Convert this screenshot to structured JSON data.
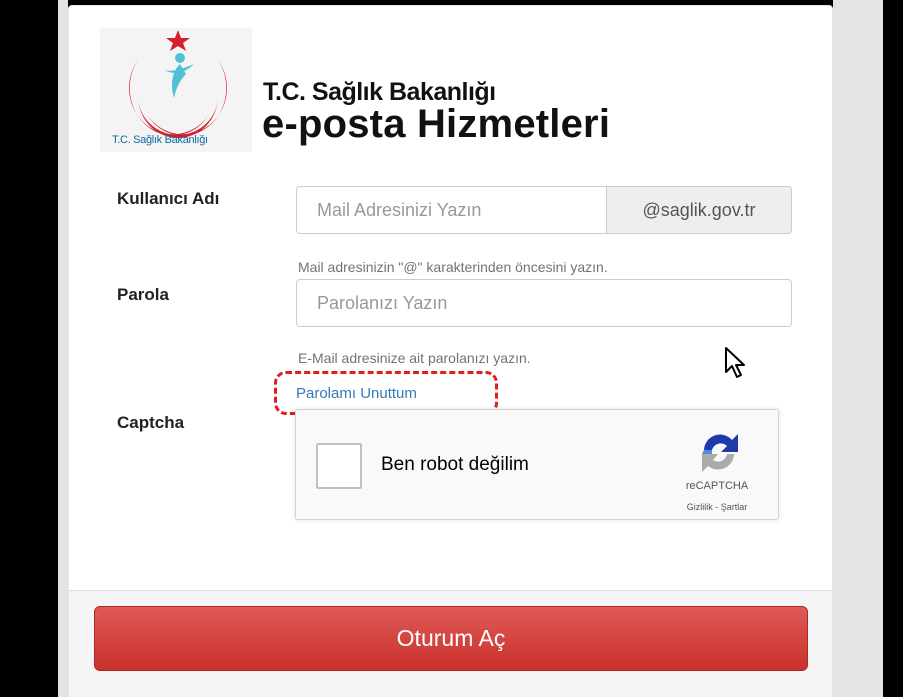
{
  "logo": {
    "caption": "T.C. Sağlık Bakanlığı",
    "colors": {
      "red": "#d21f2a",
      "teal": "#4fc1d6"
    }
  },
  "brand": {
    "line1": "T.C. Sağlık Bakanlığı",
    "line2": "e-posta Hizmetleri"
  },
  "username": {
    "label": "Kullanıcı Adı",
    "placeholder": "Mail Adresinizi Yazın",
    "domain": "@saglik.gov.tr",
    "help": "Mail adresinizin \"@\" karakterinden öncesini yazın."
  },
  "password": {
    "label": "Parola",
    "placeholder": "Parolanızı Yazın",
    "help": "E-Mail adresinize ait parolanızı yazın.",
    "forgot": "Parolamı Unuttum"
  },
  "captcha": {
    "label": "Captcha",
    "checkbox_label": "Ben robot değilim",
    "brand": "reCAPTCHA",
    "links": "Gizlilik - Şartlar"
  },
  "submit": {
    "label": "Oturum Aç"
  },
  "colors": {
    "submit": "#c9302c",
    "link": "#337ab7",
    "highlight": "#e01e1e"
  }
}
